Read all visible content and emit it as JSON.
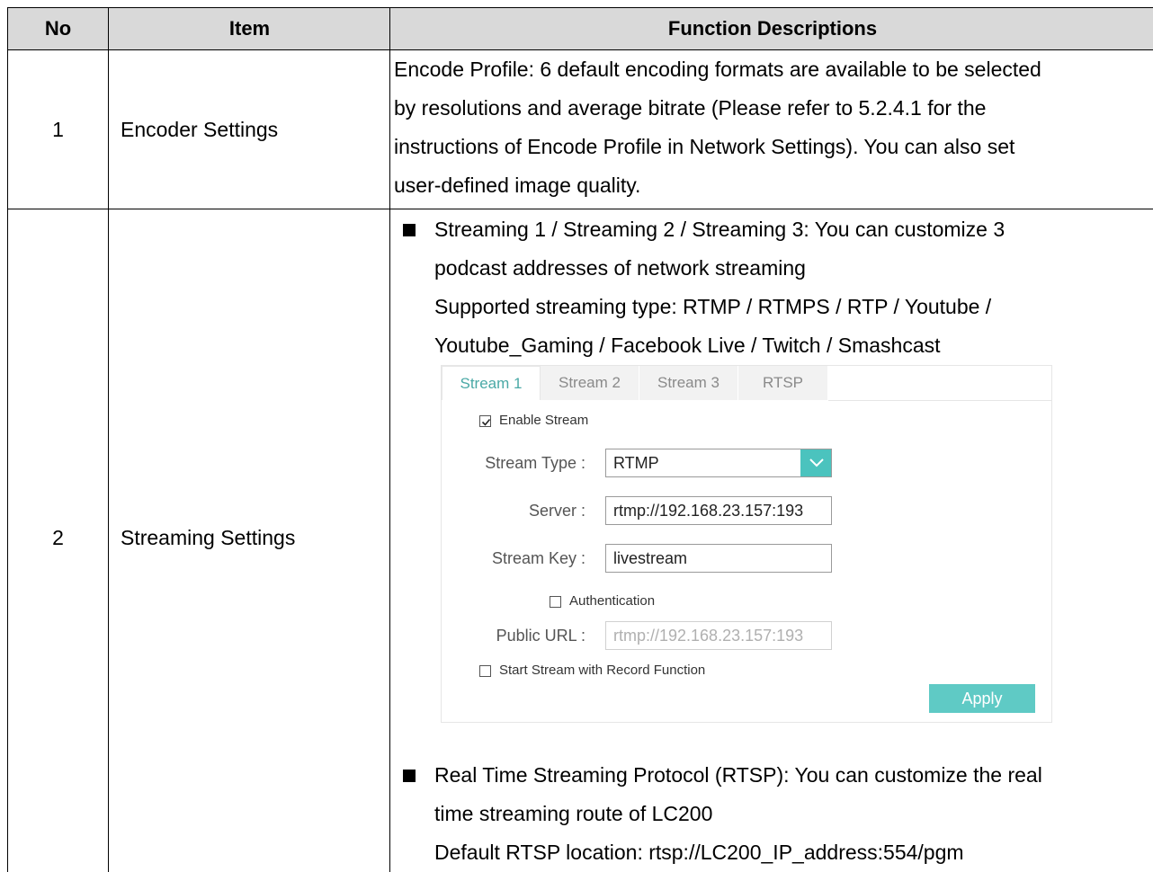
{
  "table": {
    "headers": {
      "no": "No",
      "item": "Item",
      "desc": "Function Descriptions"
    },
    "row1": {
      "no": "1",
      "item": "Encoder Settings",
      "lines": [
        "Encode Profile: 6 default encoding formats are available to be selected",
        "by resolutions and average bitrate (Please refer to 5.2.4.1 for the",
        "instructions of Encode Profile in Network Settings). You can also set",
        "user-defined image quality."
      ]
    },
    "row2": {
      "no": "2",
      "item": "Streaming Settings",
      "bullet1_lines": [
        "Streaming 1 / Streaming 2 / Streaming 3: You can customize 3",
        "podcast addresses of network streaming",
        "Supported streaming type: RTMP / RTMPS / RTP / Youtube /",
        "Youtube_Gaming / Facebook Live / Twitch / Smashcast"
      ],
      "bullet2_lines": [
        "Real Time Streaming Protocol (RTSP): You can customize the real",
        "time streaming route of LC200",
        "Default RTSP location: rtsp://LC200_IP_address:554/pgm"
      ]
    }
  },
  "ui": {
    "tabs": [
      "Stream 1",
      "Stream 2",
      "Stream 3",
      "RTSP"
    ],
    "active_tab": "Stream 1",
    "enable_stream": {
      "label": "Enable Stream",
      "checked": true
    },
    "stream_type": {
      "label": "Stream Type :",
      "value": "RTMP"
    },
    "server": {
      "label": "Server :",
      "value": "rtmp://192.168.23.157:193"
    },
    "stream_key": {
      "label": "Stream Key :",
      "value": "livestream"
    },
    "authentication": {
      "label": "Authentication",
      "checked": false
    },
    "public_url": {
      "label": "Public URL :",
      "value": "rtmp://192.168.23.157:193"
    },
    "start_with_record": {
      "label": "Start Stream with Record Function",
      "checked": false
    },
    "apply_label": "Apply",
    "accent_color": "#4bc3be"
  }
}
